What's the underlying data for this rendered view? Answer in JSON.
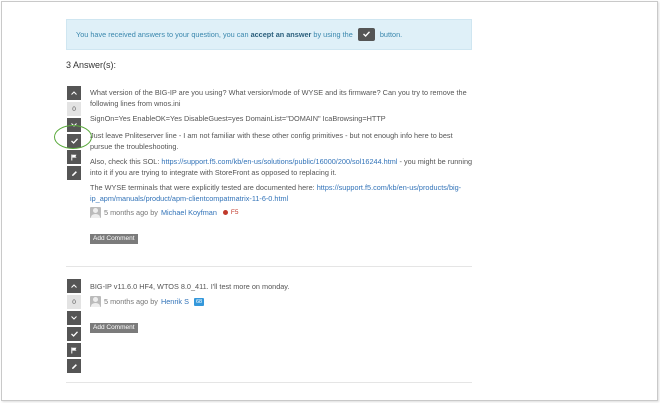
{
  "notice": {
    "before": "You have received answers to your question, you can ",
    "strong": "accept an answer",
    "after_strong": " by using the ",
    "after_button": " button."
  },
  "answers_count": "3 Answer(s):",
  "answers": [
    {
      "score": "0",
      "para1": "What version of the BIG-IP are you using? What version/mode of WYSE and its firmware? Can you try to remove the following lines from wnos.ini",
      "para2": "SignOn=Yes EnableOK=Yes DisableGuest=yes DomainList=\"DOMAIN\" IcaBrowsing=HTTP",
      "para3": "Just leave Pnliteserver line - I am not familiar with these other config primitives - but not enough info here to best pursue the troubleshooting.",
      "para4_before": "Also, check this SOL: ",
      "para4_link": "https://support.f5.com/kb/en-us/solutions/public/16000/200/sol16244.html",
      "para4_after": " - you might be running into it if you are trying to integrate with StoreFront as opposed to replacing it.",
      "para5_before": "The WYSE terminals that were explicitly tested are documented here: ",
      "para5_link": "https://support.f5.com/kb/en-us/products/big-ip_apm/manuals/product/apm-clientcompatmatrix-11-6-0.html",
      "time": "5 months ago by",
      "author": "Michael Koyfman",
      "badge": "F5",
      "add_comment": "Add Comment"
    },
    {
      "score": "0",
      "para1": "BIG-IP v11.6.0 HF4, WTOS 8.0_411. I'll test more on monday.",
      "time": "5 months ago by",
      "author": "Henrik S",
      "rep": "68",
      "add_comment": "Add Comment"
    }
  ]
}
